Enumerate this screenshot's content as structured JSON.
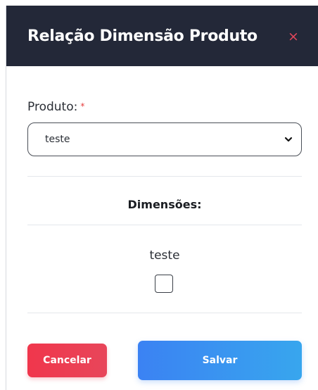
{
  "modal": {
    "title": "Relação Dimensão Produto",
    "close_label": "×"
  },
  "form": {
    "product_label": "Produto:",
    "required_mark": "*",
    "product_selected": "teste",
    "dimensions_title": "Dimensões:",
    "dimension_options": [
      {
        "label": "teste",
        "checked": false
      }
    ]
  },
  "actions": {
    "cancel_label": "Cancelar",
    "save_label": "Salvar"
  },
  "colors": {
    "header_bg": "#232838",
    "close_icon": "#e4475b",
    "required_mark": "#e53c3c",
    "cancel_button": "#f0364c",
    "save_button": "#3b82f3"
  },
  "icons": {
    "close": "close-icon",
    "select_arrow": "chevron-down-icon"
  }
}
